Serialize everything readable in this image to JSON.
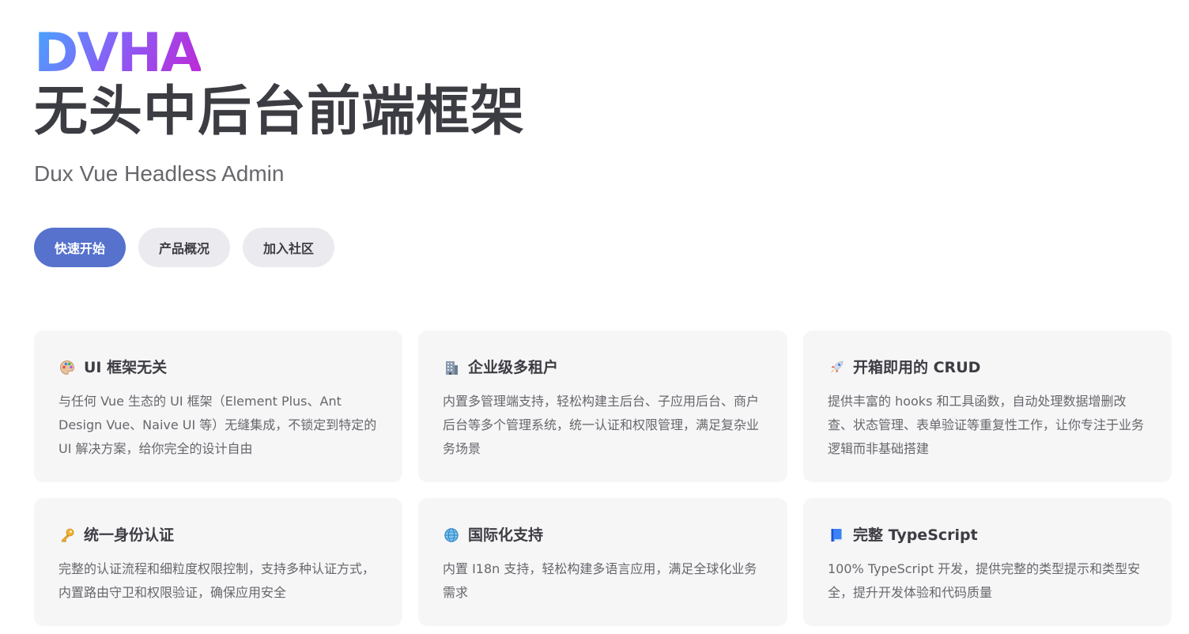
{
  "hero": {
    "brand": "DVHA",
    "headline": "无头中后台前端框架",
    "tagline": "Dux Vue Headless Admin"
  },
  "actions": [
    {
      "label": "快速开始"
    },
    {
      "label": "产品概况"
    },
    {
      "label": "加入社区"
    }
  ],
  "features": [
    {
      "icon": "palette-icon",
      "title": "UI 框架无关",
      "desc": "与任何 Vue 生态的 UI 框架（Element Plus、Ant Design Vue、Naive UI 等）无缝集成，不锁定到特定的 UI 解决方案，给你完全的设计自由"
    },
    {
      "icon": "office-building-icon",
      "title": "企业级多租户",
      "desc": "内置多管理端支持，轻松构建主后台、子应用后台、商户后台等多个管理系统，统一认证和权限管理，满足复杂业务场景"
    },
    {
      "icon": "rocket-icon",
      "title": "开箱即用的 CRUD",
      "desc": "提供丰富的 hooks 和工具函数，自动处理数据增删改查、状态管理、表单验证等重复性工作，让你专注于业务逻辑而非基础搭建"
    },
    {
      "icon": "key-icon",
      "title": "统一身份认证",
      "desc": "完整的认证流程和细粒度权限控制，支持多种认证方式，内置路由守卫和权限验证，确保应用安全"
    },
    {
      "icon": "globe-icon",
      "title": "国际化支持",
      "desc": "内置 I18n 支持，轻松构建多语言应用，满足全球化业务需求"
    },
    {
      "icon": "blue-book-icon",
      "title": "完整 TypeScript",
      "desc": "100% TypeScript 开发，提供完整的类型提示和类型安全，提升开发体验和代码质量"
    }
  ]
}
